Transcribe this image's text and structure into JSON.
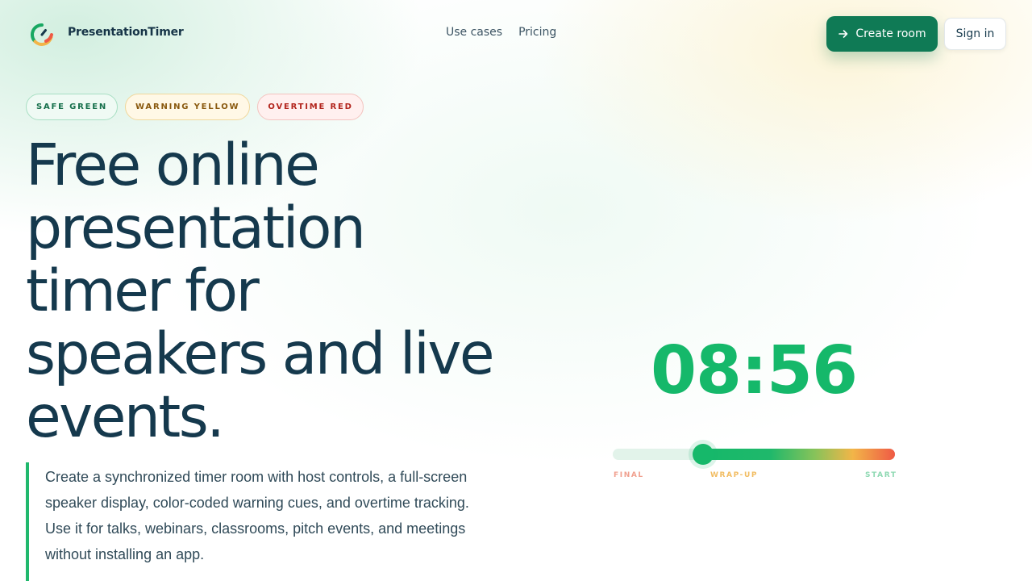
{
  "header": {
    "brand": "PresentationTimer",
    "logo_icon": "timer-logo-icon",
    "nav": [
      {
        "label": "Use cases"
      },
      {
        "label": "Pricing"
      }
    ],
    "create_room_label": "Create room",
    "create_room_icon": "arrow-right-icon",
    "sign_in_label": "Sign in"
  },
  "badges": [
    {
      "label": "SAFE GREEN",
      "color": "#17704c"
    },
    {
      "label": "WARNING YELLOW",
      "color": "#8a5a10"
    },
    {
      "label": "OVERTIME RED",
      "color": "#b3261e"
    }
  ],
  "hero": {
    "headline": "Free online presentation timer for speakers and live events.",
    "lead": "Create a synchronized timer room with host controls, a full-screen speaker display, color-coded warning cues, and overtime tracking. Use it for talks, webinars, classrooms, pitch events, and meetings without installing an app."
  },
  "timer_preview": {
    "time": "08:56",
    "progress_remaining": 0.68,
    "scale_labels": {
      "final": "FINAL",
      "wrap_up": "WRAP-UP",
      "start": "START"
    }
  },
  "colors": {
    "accent": "#0f7a55",
    "timer_green": "#15b86a",
    "warning": "#f2b548",
    "overtime": "#ef5a45",
    "text": "#15394d"
  }
}
